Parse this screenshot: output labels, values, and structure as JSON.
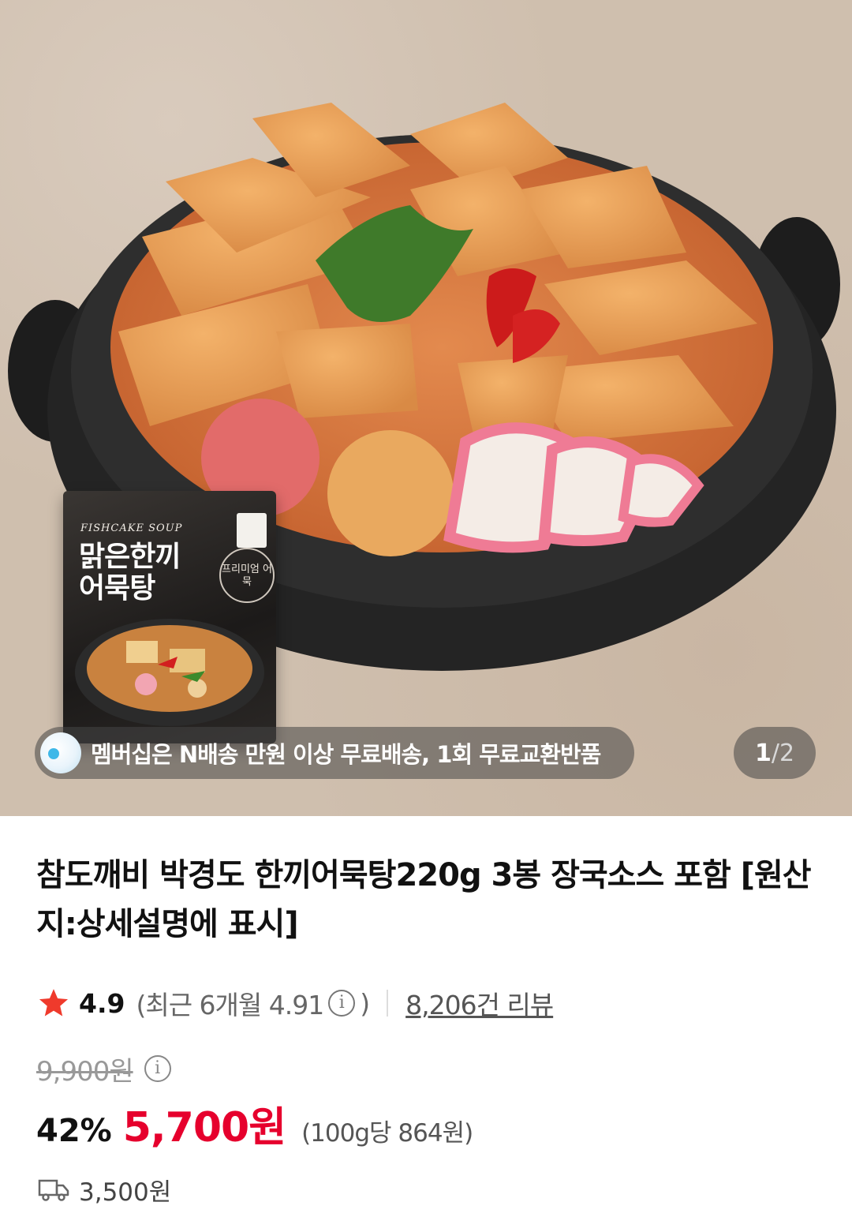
{
  "hero": {
    "pack_english": "FISHCAKE SOUP",
    "pack_title": "맑은한끼 어묵탕",
    "pack_badge": "프리미엄 어묵",
    "promo_text": "멤버십은 N배송 만원 이상 무료배송, 1회 무료교환반품",
    "image_index_current": "1",
    "image_index_separator": "/",
    "image_index_total": "2"
  },
  "product": {
    "title": "참도깨비 박경도 한끼어묵탕220g 3봉 장국소스 포함 [원산지:상세설명에 표시]"
  },
  "rating": {
    "icon": "star-icon",
    "score": "4.9",
    "recent_open": "(최근 6개월 4.91",
    "recent_close": ")",
    "reviews": "8,206건 리뷰"
  },
  "price": {
    "original": "9,900원",
    "discount": "42%",
    "sale": "5,700원",
    "unit": "(100g당 864원)"
  },
  "shipping": {
    "icon": "truck-icon",
    "fee": "3,500원"
  },
  "colors": {
    "accent_red": "#e6002d",
    "star": "#ef3a2c"
  }
}
